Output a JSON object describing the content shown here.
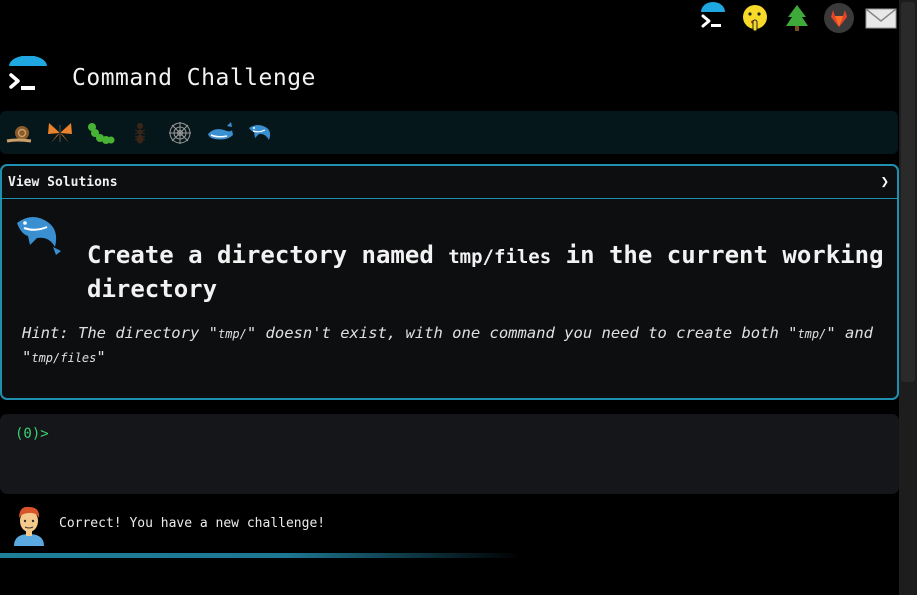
{
  "header": {
    "title": "Command Challenge"
  },
  "top_icons": [
    "terminal-icon",
    "shushing-face-icon",
    "tree-icon",
    "gitlab-icon",
    "mail-icon"
  ],
  "levels": [
    "snail-icon",
    "butterfly-icon",
    "caterpillar-icon",
    "ant-icon",
    "spider-web-icon",
    "whale-icon",
    "dolphin-icon"
  ],
  "card": {
    "toggle_label": "View Solutions",
    "toggle_chevron": "❯",
    "challenge_pre": "Create a directory named ",
    "challenge_code": "tmp/files",
    "challenge_post": " in the current working directory",
    "hint_1": "Hint: The directory \"",
    "hint_code_1": "tmp/",
    "hint_2": "\" doesn't exist, with one command you need to create both \"",
    "hint_code_2": "tmp/",
    "hint_3": "\" and \"",
    "hint_code_3": "tmp/files",
    "hint_4": "\""
  },
  "terminal": {
    "prompt": "(0)>"
  },
  "status": {
    "message": "Correct! You have a new challenge!",
    "avatar": "man-avatar-icon"
  },
  "progress": {
    "fraction": 0.58
  },
  "colors": {
    "accent": "#1f8fb0",
    "prompt_green": "#3bd16f",
    "background": "#000000"
  }
}
